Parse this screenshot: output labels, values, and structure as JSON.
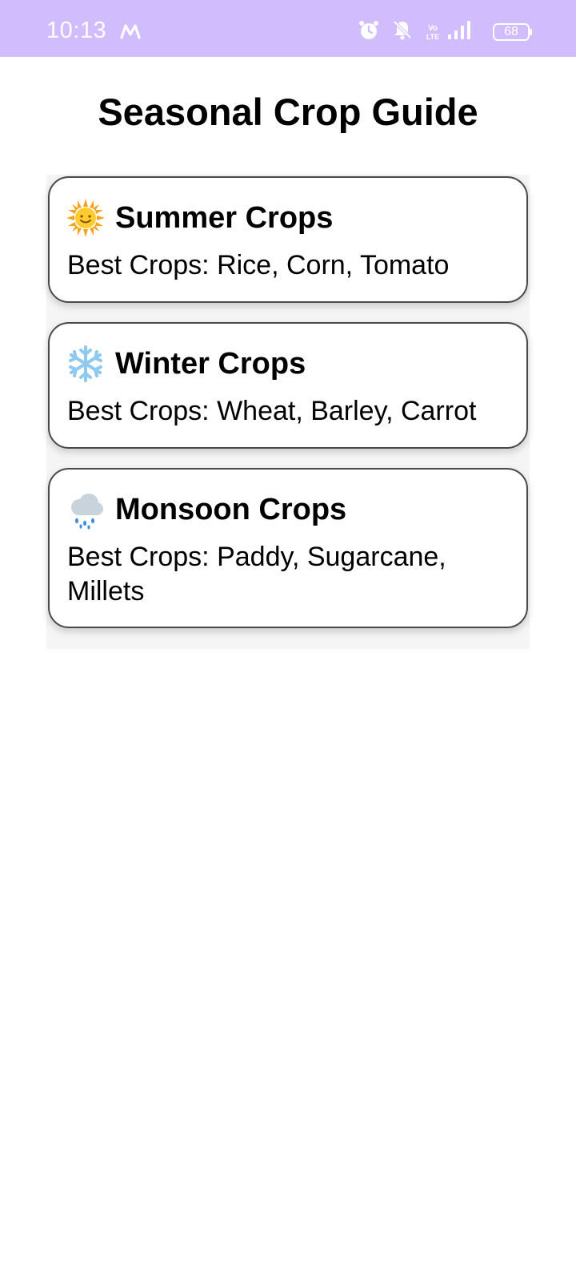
{
  "status_bar": {
    "time": "10:13",
    "battery_level": "68",
    "icons": [
      "m-icon",
      "alarm-icon",
      "bell-off-icon",
      "volte-icon",
      "signal-icon",
      "battery-icon"
    ],
    "background": "#d1bcfd"
  },
  "page": {
    "title": "Seasonal Crop Guide"
  },
  "cards": [
    {
      "icon": "sun-icon",
      "title": "Summer Crops",
      "body": "Best Crops: Rice, Corn, Tomato"
    },
    {
      "icon": "snowflake-icon",
      "title": "Winter Crops",
      "body": "Best Crops: Wheat, Barley, Carrot"
    },
    {
      "icon": "rain-cloud-icon",
      "title": "Monsoon Crops",
      "body": "Best Crops: Paddy, Sugarcane, Millets"
    }
  ]
}
